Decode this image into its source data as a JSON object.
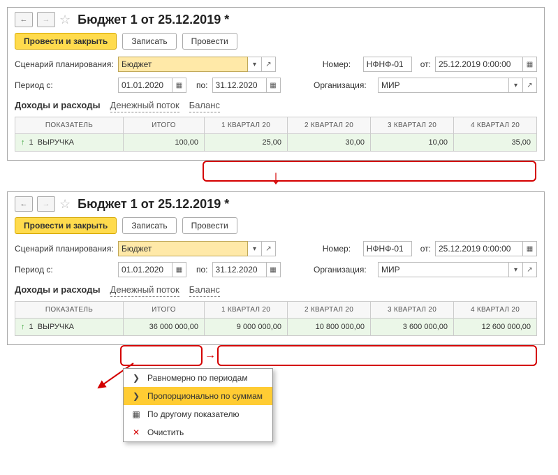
{
  "panelA": {
    "title": "Бюджет 1 от 25.12.2019 *",
    "btn_primary": "Провести и закрыть",
    "btn_save": "Записать",
    "btn_post": "Провести",
    "lbl_scenario": "Сценарий планирования:",
    "val_scenario": "Бюджет",
    "lbl_number": "Номер:",
    "val_number": "НФНФ-01",
    "lbl_from": "от:",
    "val_date": "25.12.2019  0:00:00",
    "lbl_period_from": "Период с:",
    "val_period_from": "01.01.2020",
    "lbl_period_to": "по:",
    "val_period_to": "31.12.2020",
    "lbl_org": "Организация:",
    "val_org": "МИР",
    "tab_income": "Доходы и расходы",
    "tab_cashflow": "Денежный поток",
    "tab_balance": "Баланс",
    "th_indicator": "Показатель",
    "th_total": "Итого",
    "th_q1": "1 квартал 20",
    "th_q2": "2 квартал 20",
    "th_q3": "3 квартал 20",
    "th_q4": "4 квартал 20",
    "row_id": "1",
    "row_name": "ВЫРУЧКА",
    "row_total": "100,00",
    "row_q1": "25,00",
    "row_q2": "30,00",
    "row_q3": "10,00",
    "row_q4": "35,00"
  },
  "panelB": {
    "title": "Бюджет 1 от 25.12.2019 *",
    "btn_primary": "Провести и закрыть",
    "btn_save": "Записать",
    "btn_post": "Провести",
    "lbl_scenario": "Сценарий планирования:",
    "val_scenario": "Бюджет",
    "lbl_number": "Номер:",
    "val_number": "НФНФ-01",
    "lbl_from": "от:",
    "val_date": "25.12.2019  0:00:00",
    "lbl_period_from": "Период с:",
    "val_period_from": "01.01.2020",
    "lbl_period_to": "по:",
    "val_period_to": "31.12.2020",
    "lbl_org": "Организация:",
    "val_org": "МИР",
    "tab_income": "Доходы и расходы",
    "tab_cashflow": "Денежный поток",
    "tab_balance": "Баланс",
    "th_indicator": "Показатель",
    "th_total": "Итого",
    "th_q1": "1 квартал 20",
    "th_q2": "2 квартал 20",
    "th_q3": "3 квартал 20",
    "th_q4": "4 квартал 20",
    "row_id": "1",
    "row_name": "ВЫРУЧКА",
    "row_total": "36 000 000,00",
    "row_q1": "9 000 000,00",
    "row_q2": "10 800 000,00",
    "row_q3": "3 600 000,00",
    "row_q4": "12 600 000,00"
  },
  "ctx": {
    "even": "Равномерно по периодам",
    "prop": "Пропорционально по суммам",
    "other": "По другому показателю",
    "clear": "Очистить"
  }
}
